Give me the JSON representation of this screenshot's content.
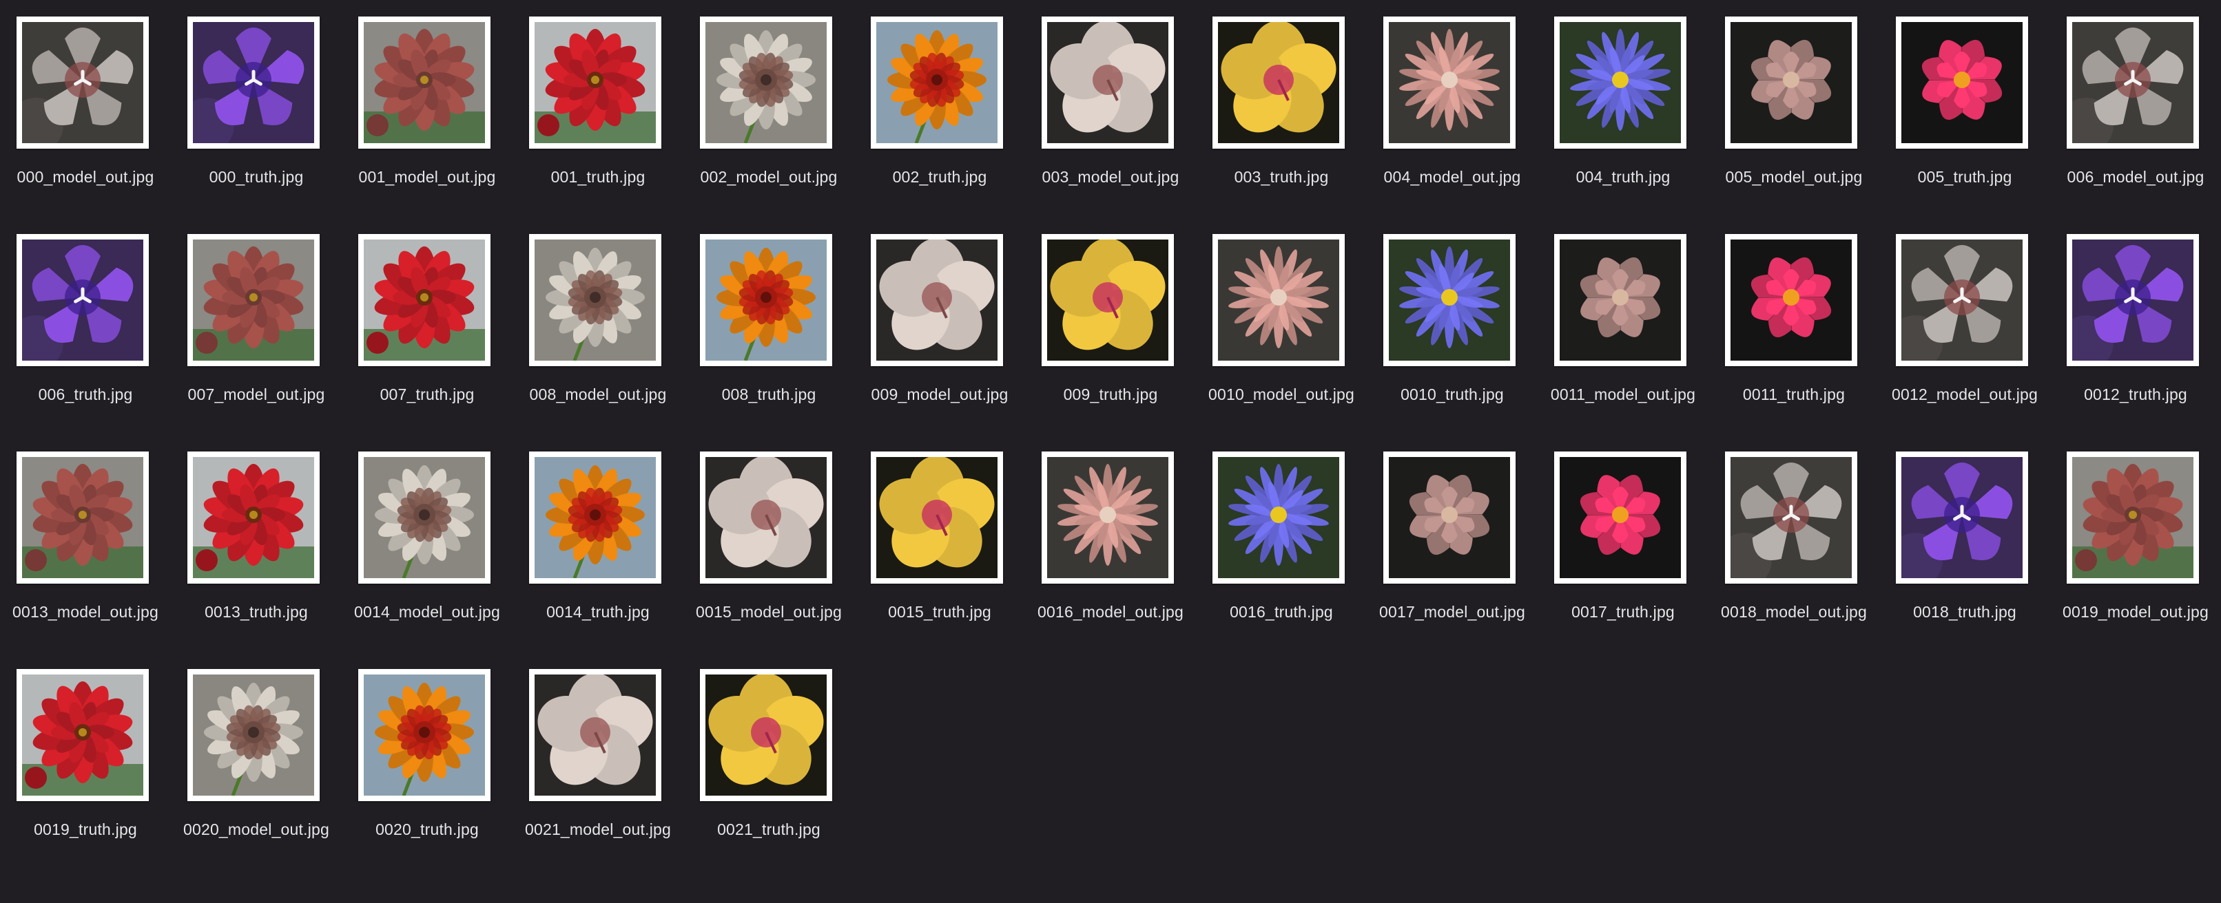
{
  "window": {
    "background": "#201e22",
    "label_color": "#e6e6e8"
  },
  "files": [
    {
      "name": "000_model_out.jpg",
      "flower": "bellflower",
      "petal": "#b8b2ae",
      "center": "#8a4a4a",
      "bg": "#3f3d3a"
    },
    {
      "name": "000_truth.jpg",
      "flower": "bellflower",
      "petal": "#8a4fe0",
      "center": "#3b1f8a",
      "bg": "#3a2a55"
    },
    {
      "name": "001_model_out.jpg",
      "flower": "dahlia",
      "petal": "#a8524c",
      "center": "#6a3a32",
      "bg": "#8b8a84"
    },
    {
      "name": "001_truth.jpg",
      "flower": "dahlia",
      "petal": "#d8202a",
      "center": "#6b2a10",
      "bg": "#b5b8b8"
    },
    {
      "name": "002_model_out.jpg",
      "flower": "gaillardia",
      "petal": "#d8d2c8",
      "center": "#6b4a42",
      "bg": "#8a8780"
    },
    {
      "name": "002_truth.jpg",
      "flower": "gaillardia",
      "petal": "#f08a10",
      "center": "#a01a10",
      "bg": "#8aa0b0"
    },
    {
      "name": "003_model_out.jpg",
      "flower": "hibiscus",
      "petal": "#e0d4cc",
      "center": "#9a5a5a",
      "bg": "#2a2826"
    },
    {
      "name": "003_truth.jpg",
      "flower": "hibiscus",
      "petal": "#f2c840",
      "center": "#c83060",
      "bg": "#1a1a12"
    },
    {
      "name": "004_model_out.jpg",
      "flower": "aster",
      "petal": "#d09890",
      "center": "#e8d0c0",
      "bg": "#3a3834"
    },
    {
      "name": "004_truth.jpg",
      "flower": "aster",
      "petal": "#6a6ae0",
      "center": "#e8c820",
      "bg": "#2a3a24"
    },
    {
      "name": "005_model_out.jpg",
      "flower": "lotus",
      "petal": "#b08884",
      "center": "#d8b8a0",
      "bg": "#1c1c1a"
    },
    {
      "name": "005_truth.jpg",
      "flower": "lotus",
      "petal": "#e83468",
      "center": "#f0a020",
      "bg": "#141414"
    },
    {
      "name": "006_model_out.jpg",
      "flower": "bellflower",
      "petal": "#b8b2ae",
      "center": "#8a4a4a",
      "bg": "#3f3d3a"
    },
    {
      "name": "006_truth.jpg",
      "flower": "bellflower",
      "petal": "#8a4fe0",
      "center": "#3b1f8a",
      "bg": "#3a2a55"
    },
    {
      "name": "007_model_out.jpg",
      "flower": "dahlia",
      "petal": "#a8524c",
      "center": "#6a3a32",
      "bg": "#8b8a84"
    },
    {
      "name": "007_truth.jpg",
      "flower": "dahlia",
      "petal": "#d8202a",
      "center": "#6b2a10",
      "bg": "#b5b8b8"
    },
    {
      "name": "008_model_out.jpg",
      "flower": "gaillardia",
      "petal": "#d8d2c8",
      "center": "#6b4a42",
      "bg": "#8a8780"
    },
    {
      "name": "008_truth.jpg",
      "flower": "gaillardia",
      "petal": "#f08a10",
      "center": "#a01a10",
      "bg": "#8aa0b0"
    },
    {
      "name": "009_model_out.jpg",
      "flower": "hibiscus",
      "petal": "#e0d4cc",
      "center": "#9a5a5a",
      "bg": "#2a2826"
    },
    {
      "name": "009_truth.jpg",
      "flower": "hibiscus",
      "petal": "#f2c840",
      "center": "#c83060",
      "bg": "#1a1a12"
    },
    {
      "name": "0010_model_out.jpg",
      "flower": "aster",
      "petal": "#d09890",
      "center": "#e8d0c0",
      "bg": "#3a3834"
    },
    {
      "name": "0010_truth.jpg",
      "flower": "aster",
      "petal": "#6a6ae0",
      "center": "#e8c820",
      "bg": "#2a3a24"
    },
    {
      "name": "0011_model_out.jpg",
      "flower": "lotus",
      "petal": "#b08884",
      "center": "#d8b8a0",
      "bg": "#1c1c1a"
    },
    {
      "name": "0011_truth.jpg",
      "flower": "lotus",
      "petal": "#e83468",
      "center": "#f0a020",
      "bg": "#141414"
    },
    {
      "name": "0012_model_out.jpg",
      "flower": "bellflower",
      "petal": "#b8b2ae",
      "center": "#8a4a4a",
      "bg": "#3f3d3a"
    },
    {
      "name": "0012_truth.jpg",
      "flower": "bellflower",
      "petal": "#8a4fe0",
      "center": "#3b1f8a",
      "bg": "#3a2a55"
    },
    {
      "name": "0013_model_out.jpg",
      "flower": "dahlia",
      "petal": "#a8524c",
      "center": "#6a3a32",
      "bg": "#8b8a84"
    },
    {
      "name": "0013_truth.jpg",
      "flower": "dahlia",
      "petal": "#d8202a",
      "center": "#6b2a10",
      "bg": "#b5b8b8"
    },
    {
      "name": "0014_model_out.jpg",
      "flower": "gaillardia",
      "petal": "#d8d2c8",
      "center": "#6b4a42",
      "bg": "#8a8780"
    },
    {
      "name": "0014_truth.jpg",
      "flower": "gaillardia",
      "petal": "#f08a10",
      "center": "#a01a10",
      "bg": "#8aa0b0"
    },
    {
      "name": "0015_model_out.jpg",
      "flower": "hibiscus",
      "petal": "#e0d4cc",
      "center": "#9a5a5a",
      "bg": "#2a2826"
    },
    {
      "name": "0015_truth.jpg",
      "flower": "hibiscus",
      "petal": "#f2c840",
      "center": "#c83060",
      "bg": "#1a1a12"
    },
    {
      "name": "0016_model_out.jpg",
      "flower": "aster",
      "petal": "#d09890",
      "center": "#e8d0c0",
      "bg": "#3a3834"
    },
    {
      "name": "0016_truth.jpg",
      "flower": "aster",
      "petal": "#6a6ae0",
      "center": "#e8c820",
      "bg": "#2a3a24"
    },
    {
      "name": "0017_model_out.jpg",
      "flower": "lotus",
      "petal": "#b08884",
      "center": "#d8b8a0",
      "bg": "#1c1c1a"
    },
    {
      "name": "0017_truth.jpg",
      "flower": "lotus",
      "petal": "#e83468",
      "center": "#f0a020",
      "bg": "#141414"
    },
    {
      "name": "0018_model_out.jpg",
      "flower": "bellflower",
      "petal": "#b8b2ae",
      "center": "#8a4a4a",
      "bg": "#3f3d3a"
    },
    {
      "name": "0018_truth.jpg",
      "flower": "bellflower",
      "petal": "#8a4fe0",
      "center": "#3b1f8a",
      "bg": "#3a2a55"
    },
    {
      "name": "0019_model_out.jpg",
      "flower": "dahlia",
      "petal": "#a8524c",
      "center": "#6a3a32",
      "bg": "#8b8a84"
    },
    {
      "name": "0019_truth.jpg",
      "flower": "dahlia",
      "petal": "#d8202a",
      "center": "#6b2a10",
      "bg": "#b5b8b8"
    },
    {
      "name": "0020_model_out.jpg",
      "flower": "gaillardia",
      "petal": "#d8d2c8",
      "center": "#6b4a42",
      "bg": "#8a8780"
    },
    {
      "name": "0020_truth.jpg",
      "flower": "gaillardia",
      "petal": "#f08a10",
      "center": "#a01a10",
      "bg": "#8aa0b0"
    },
    {
      "name": "0021_model_out.jpg",
      "flower": "hibiscus",
      "petal": "#e0d4cc",
      "center": "#9a5a5a",
      "bg": "#2a2826"
    },
    {
      "name": "0021_truth.jpg",
      "flower": "hibiscus",
      "petal": "#f2c840",
      "center": "#c83060",
      "bg": "#1a1a12"
    }
  ]
}
